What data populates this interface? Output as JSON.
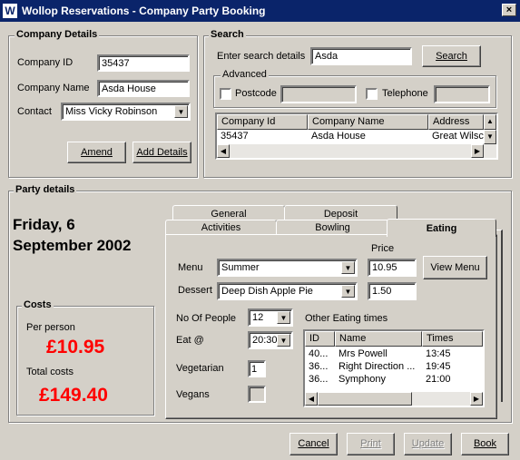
{
  "window": {
    "app_icon": "W",
    "title": "Wollop Reservations - Company Party Booking",
    "close_label": "×"
  },
  "company": {
    "legend": "Company Details",
    "id_label": "Company ID",
    "id_value": "35437",
    "name_label": "Company Name",
    "name_value": "Asda House",
    "contact_label": "Contact",
    "contact_value": "Miss Vicky Robinson",
    "amend_label": "Amend",
    "add_details_label": "Add Details"
  },
  "search": {
    "legend": "Search",
    "enter_label": "Enter search details",
    "value": "Asda",
    "button_label": "Search",
    "advanced_legend": "Advanced",
    "postcode_label": "Postcode",
    "telephone_label": "Telephone",
    "results_columns": [
      "Company Id",
      "Company Name",
      "Address"
    ],
    "results_rows": [
      [
        "35437",
        "Asda House",
        "Great Wilsc"
      ]
    ]
  },
  "party": {
    "legend": "Party details",
    "date_line1": "Friday, 6",
    "date_line2": "September 2002",
    "costs": {
      "legend": "Costs",
      "per_person_label": "Per person",
      "per_person_value": "£10.95",
      "total_label": "Total costs",
      "total_value": "£149.40"
    },
    "tabs_back": [
      "General",
      "Deposit"
    ],
    "tabs_front": [
      "Activities",
      "Bowling",
      "Eating"
    ],
    "active_tab": "Eating",
    "eating": {
      "price_label": "Price",
      "menu_label": "Menu",
      "menu_value": "Summer",
      "menu_price": "10.95",
      "view_menu_label": "View Menu",
      "dessert_label": "Dessert",
      "dessert_value": "Deep Dish Apple Pie",
      "dessert_price": "1.50",
      "people_label": "No Of People",
      "people_value": "12",
      "eat_label": "Eat @",
      "eat_value": "20:30",
      "vegetarian_label": "Vegetarian",
      "vegetarian_value": "1",
      "vegans_label": "Vegans",
      "other_times_label": "Other Eating times",
      "times_columns": [
        "ID",
        "Name",
        "Times"
      ],
      "times_rows": [
        [
          "40...",
          "Mrs  Powell",
          "13:45"
        ],
        [
          "36...",
          "Right Direction ...",
          "19:45"
        ],
        [
          "36...",
          "Symphony",
          "21:00"
        ]
      ]
    }
  },
  "footer": {
    "cancel_label": "Cancel",
    "print_label": "Print",
    "update_label": "Update",
    "book_label": "Book"
  }
}
